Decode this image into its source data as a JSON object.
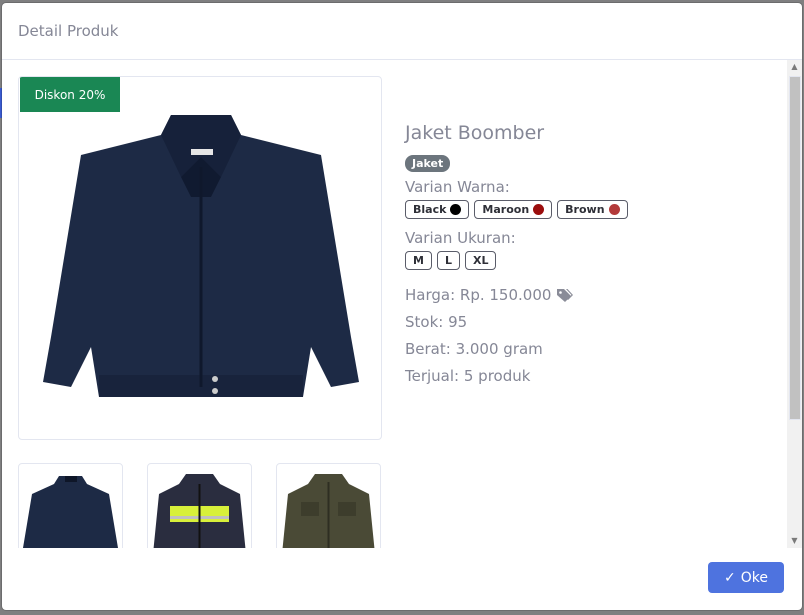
{
  "modal": {
    "title": "Detail Produk",
    "ok_label": "Oke"
  },
  "product": {
    "discount_badge": "Diskon 20%",
    "name": "Jaket Boomber",
    "category": "Jaket",
    "color_label": "Varian Warna:",
    "colors": [
      {
        "name": "Black",
        "hex": "#000000"
      },
      {
        "name": "Maroon",
        "hex": "#9b0d0d"
      },
      {
        "name": "Brown",
        "hex": "#b33a3a"
      }
    ],
    "size_label": "Varian Ukuran:",
    "sizes": [
      "M",
      "L",
      "XL"
    ],
    "price": "Harga: Rp. 150.000",
    "stock": "Stok: 95",
    "weight": "Berat: 3.000 gram",
    "sold": "Terjual: 5 produk"
  },
  "thumbnails": [
    {
      "name": "navy-bomber-jacket"
    },
    {
      "name": "safety-work-jacket"
    },
    {
      "name": "olive-field-jacket"
    }
  ],
  "colors": {
    "discount_bg": "#1a8754",
    "primary_btn": "#4e73df",
    "muted_text": "#858796"
  }
}
